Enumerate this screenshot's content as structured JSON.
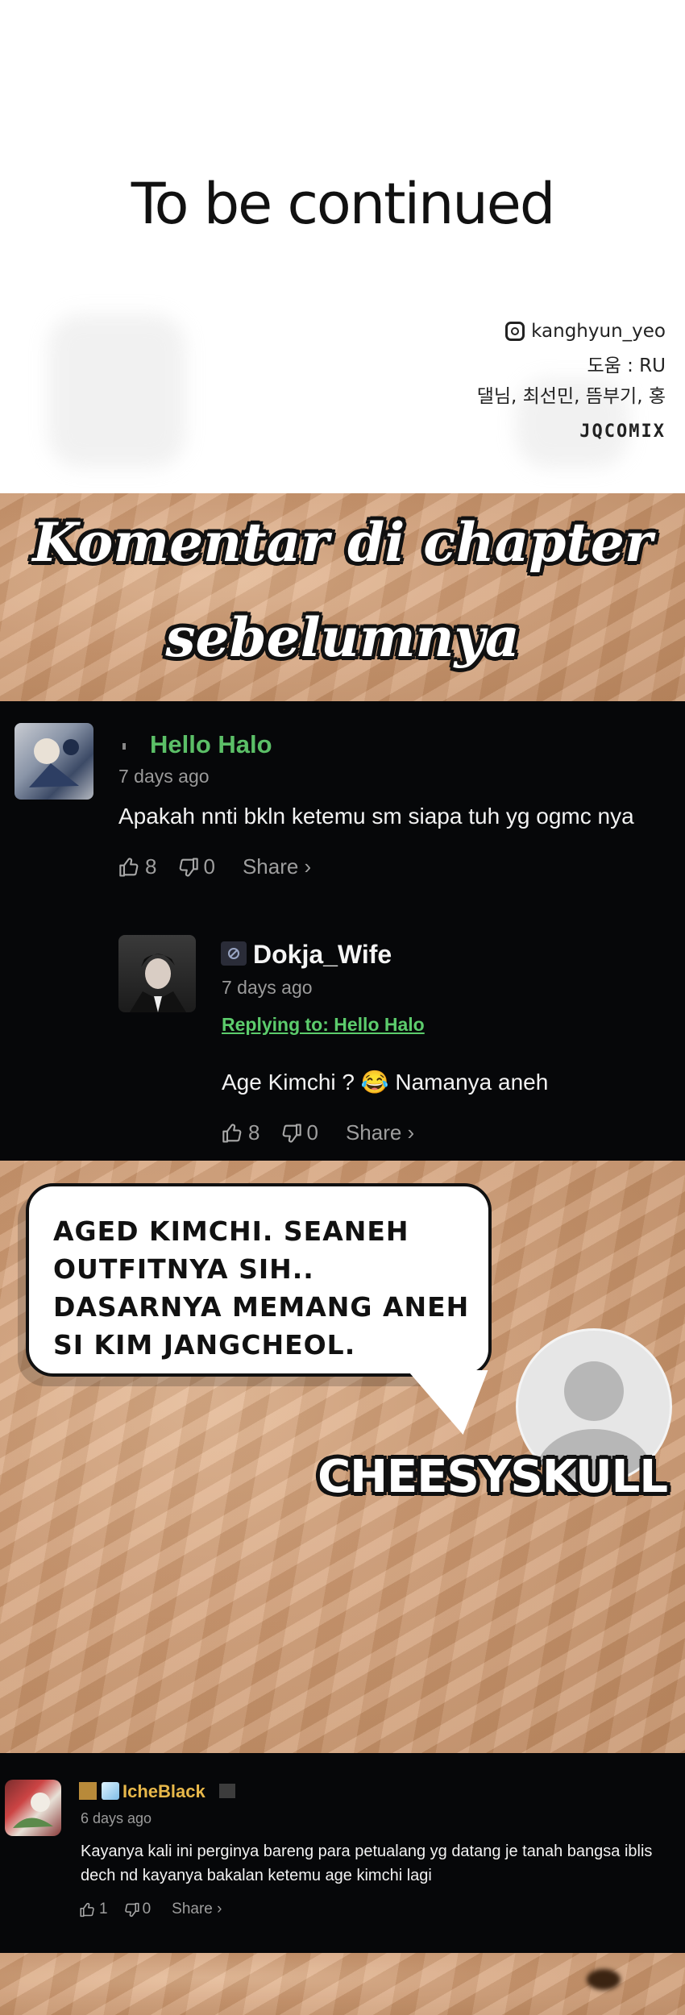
{
  "top": {
    "title": "To be continued",
    "credits": {
      "instagram": "kanghyun_yeo",
      "help": "도움 : RU",
      "names": "댈님, 최선민, 뜸부기, 홍",
      "logo": "JQCOMIX"
    }
  },
  "heading": {
    "line1": "Komentar di chapter",
    "line2": "sebelumnya"
  },
  "comment1": {
    "user": "Hello Halo",
    "time": "7 days ago",
    "text": "Apakah nnti bkln ketemu sm siapa tuh yg ogmc nya",
    "likes": "8",
    "dislikes": "0",
    "share": "Share ›",
    "name_color": "#5bbf67"
  },
  "reply1": {
    "user": "Dokja_Wife",
    "time": "7 days ago",
    "replying": "Replying to: Hello Halo",
    "text": "Age Kimchi ? 😂 Namanya aneh",
    "likes": "8",
    "dislikes": "0",
    "share": "Share ›"
  },
  "bubble": {
    "text": "AGED KIMCHI. SEANEH OUTFITNYA SIH.. DASARNYA MEMANG ANEH SI KIM JANGCHEOL.",
    "signature": "CHEESYSKULL"
  },
  "comment3": {
    "user": "IcheBlack",
    "time": "6 days ago",
    "text": "Kayanya kali ini perginya bareng para petualang yg datang je tanah bangsa iblis dech nd kayanya bakalan ketemu age kimchi lagi",
    "likes": "1",
    "dislikes": "0",
    "share": "Share ›"
  }
}
